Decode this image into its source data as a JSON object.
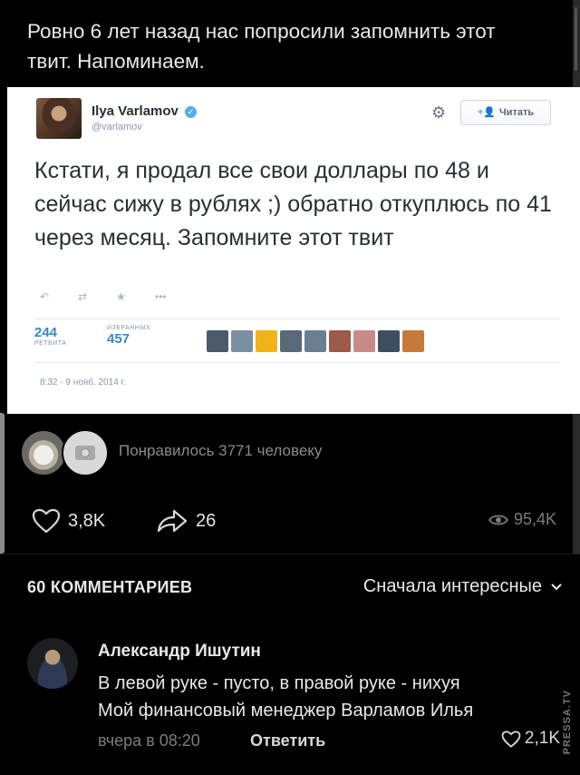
{
  "post": {
    "text": "Ровно 6 лет назад нас попросили запомнить этот твит. Напоминаем."
  },
  "tweet": {
    "author_name": "Ilya Varlamov",
    "verified_mark": "✓",
    "handle": "@varlamov",
    "follow_label": "Читать",
    "follow_plus": "+👤",
    "body": "Кстати, я продал все свои доллары по 48 и сейчас сижу в рублях ;) обратно откуплюсь по 41 через месяц. Запомните этот твит",
    "retweets_count": "244",
    "retweets_label": "РЕТВИТА",
    "favorites_label": "ИЗБРАННЫХ",
    "favorites_count": "457",
    "date": "8:32 - 9 нояб. 2014 г.",
    "actions": {
      "reply_icon": "reply-icon",
      "retweet_icon": "retweet-icon",
      "favorite_icon": "star-icon",
      "more_icon": "more-icon"
    },
    "face_colors": [
      "#4a5a6a",
      "#7a8fa0",
      "#f2b21b",
      "#586a78",
      "#6a7f90",
      "#9b5a4a",
      "#c98a8a",
      "#3e4e5e",
      "#c67a3a"
    ]
  },
  "likes": {
    "text": "Понравилось 3771 человеку"
  },
  "stats": {
    "likes": "3,8K",
    "shares": "26",
    "views": "95,4K"
  },
  "comments": {
    "header": "60 КОММЕНТАРИЕВ",
    "sort_label": "Сначала интересные",
    "items": [
      {
        "author": "Александр Ишутин",
        "line1": "В левой руке - пусто, в правой руке - нихуя",
        "line2": "Мой финансовый менеджер Варламов Илья",
        "time": "вчера в 08:20",
        "reply_label": "Ответить",
        "likes": "2,1K"
      }
    ]
  },
  "watermark": "PRESSA.TV"
}
